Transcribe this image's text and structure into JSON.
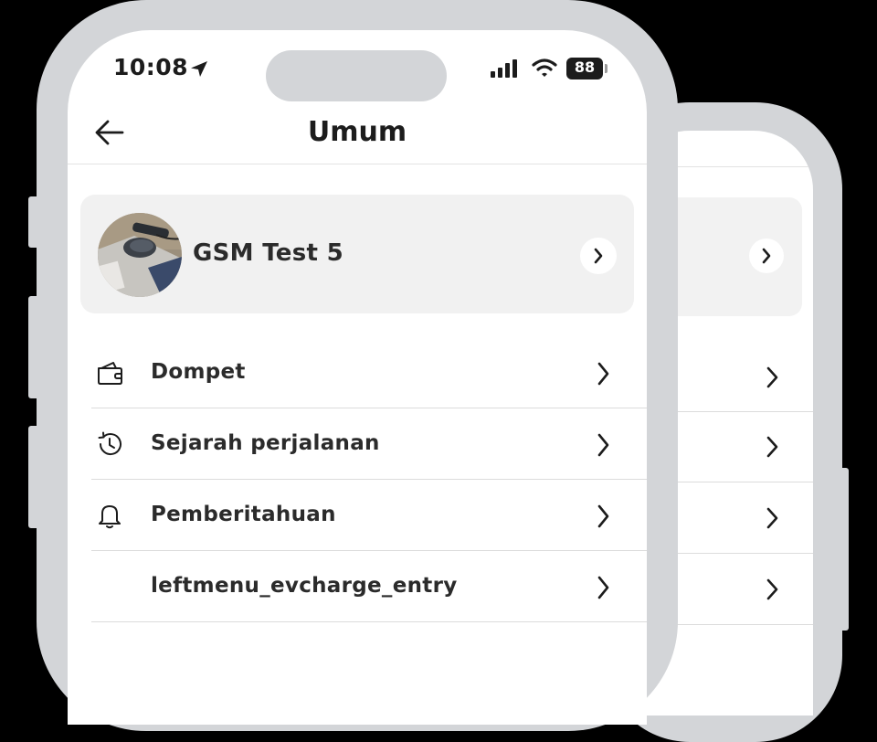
{
  "status_bar": {
    "time": "10:08",
    "battery": "88"
  },
  "header": {
    "title": "Umum"
  },
  "profile": {
    "name": "GSM Test 5"
  },
  "menu": {
    "items": [
      {
        "label": "Dompet",
        "icon": "wallet-icon"
      },
      {
        "label": "Sejarah perjalanan",
        "icon": "history-icon"
      },
      {
        "label": "Pemberitahuan",
        "icon": "bell-icon"
      },
      {
        "label": "leftmenu_evcharge_entry",
        "icon": ""
      }
    ]
  }
}
